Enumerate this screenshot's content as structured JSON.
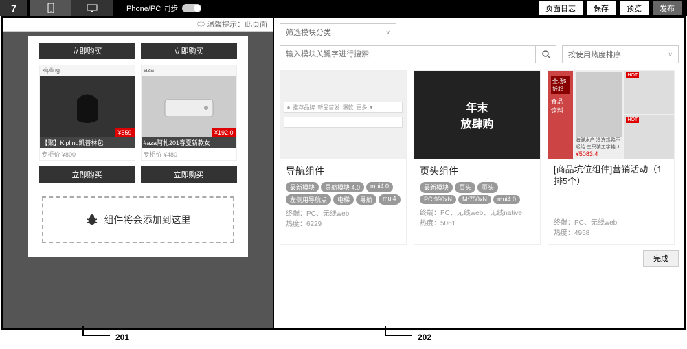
{
  "topbar": {
    "sync_label": "Phone/PC 同步",
    "actions": {
      "log_label": "页面日志",
      "save_label": "保存",
      "preview_label": "预览",
      "publish_label": "发布"
    }
  },
  "preview": {
    "notice": "◎ 温馨提示：此页面",
    "products": [
      {
        "brand": "kipling",
        "title": "【聚】Kipling凯普林包",
        "price": "¥559",
        "sub": "专柜价 ¥800"
      },
      {
        "brand": "aza",
        "title": "#aza阿札201春夏新款女",
        "price": "¥192.0",
        "sub": "专柜价 ¥480"
      }
    ],
    "buy_label": "立即购买",
    "drop_zone_text": "组件将会添加到这里"
  },
  "components": {
    "category_placeholder": "筛选模块分类",
    "search_placeholder": "输入模块关键字进行搜索...",
    "sort_label": "按使用热度排序",
    "items": [
      {
        "title": "导航组件",
        "tags": [
          "最新模块",
          "导航模块 4.0",
          "mui4.0",
          "左侧用导航点",
          "电梯",
          "导航",
          "mui4"
        ],
        "meta_terminal": "终端：PC、无线web",
        "meta_heat": "热度：6229",
        "nav_items": [
          "推荐品牌",
          "新品首发",
          "爆款",
          "更多"
        ]
      },
      {
        "title": "页头组件",
        "tags": [
          "最新模块",
          "页头",
          "页头",
          "PC:990xN",
          "M:750xN",
          "mui4.0"
        ],
        "meta_terminal": "终端：PC、无线web、无线native",
        "meta_heat": "热度：5061",
        "banner_line1": "年末",
        "banner_line2": "放肆购"
      },
      {
        "title": "[商品坑位组件]营销活动（1排5个）",
        "tags": [],
        "meta_terminal": "终端：PC、无线web",
        "meta_heat": "热度：4958",
        "promo_category": "食品\n饮料",
        "promo_desc": "海鲜水产 冷冻鸡鸭不迟给 三只装工字袖 J",
        "promo_price": "¥5083.4"
      }
    ],
    "done_label": "完成"
  },
  "figure_labels": {
    "left": "201",
    "right": "202"
  }
}
